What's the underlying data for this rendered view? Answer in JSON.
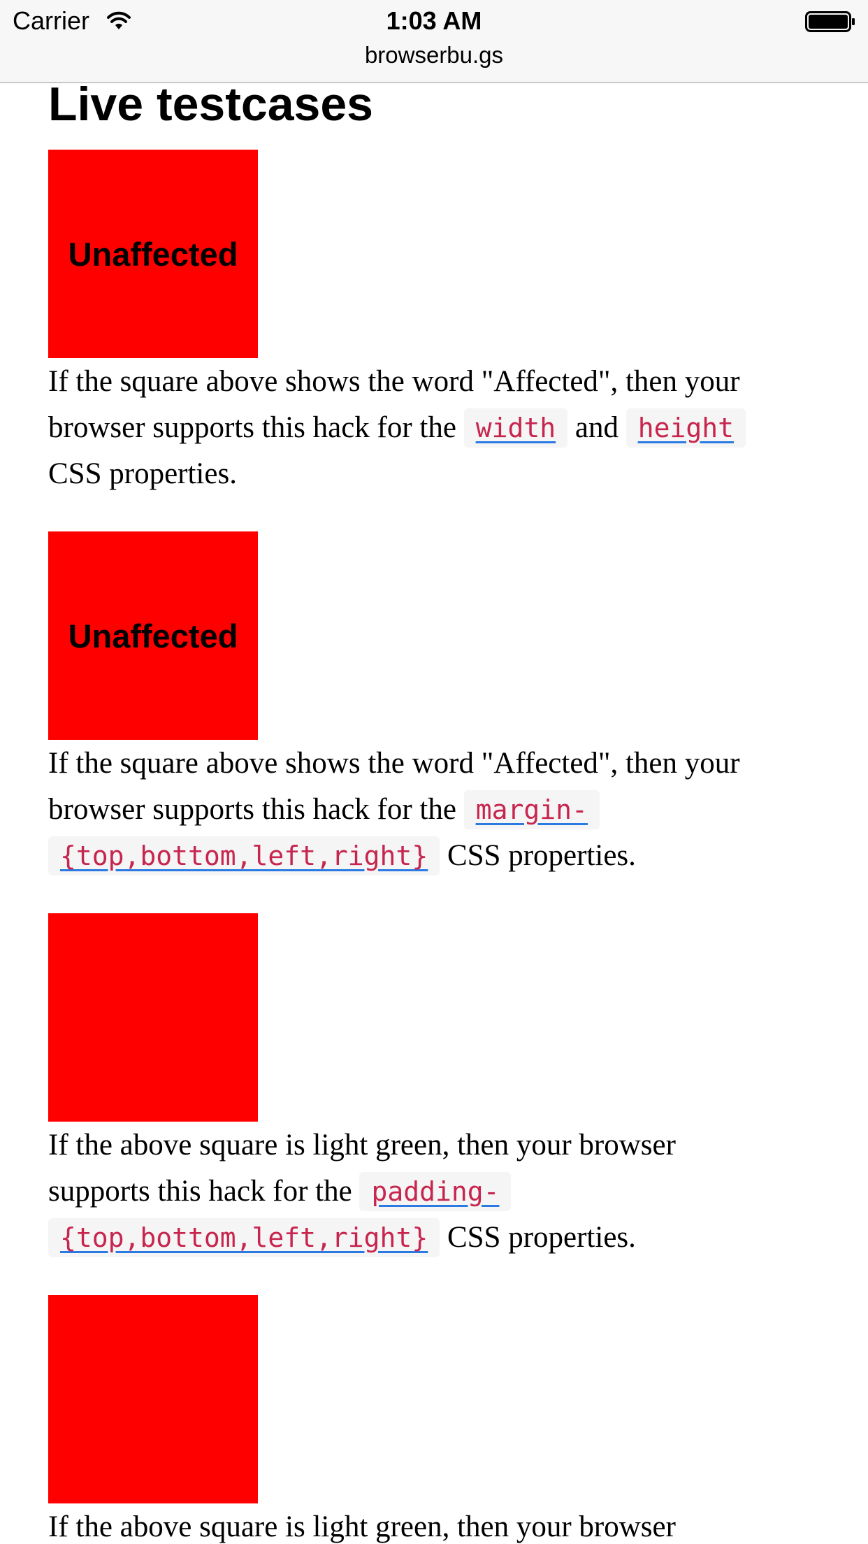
{
  "status_bar": {
    "carrier": "Carrier",
    "time": "1:03 AM",
    "wifi_icon": "wifi-icon",
    "battery_icon": "battery-full-icon"
  },
  "address_bar": {
    "url": "browserbu.gs"
  },
  "page": {
    "title": "Live testcases",
    "testcases": [
      {
        "square_label": "Unaffected",
        "square_color": "#ff0000",
        "text_before": "If the square above shows the word \"Affected\", then your browser supports this hack for the ",
        "code_1": "width",
        "text_middle": " and ",
        "code_2": "height",
        "text_after": " CSS properties."
      },
      {
        "square_label": "Unaffected",
        "square_color": "#ff0000",
        "text_before": "If the square above shows the word \"Affected\", then your browser supports this hack for the ",
        "code_1": "margin-{top,bottom,left,right}",
        "text_after": " CSS properties."
      },
      {
        "square_label": "",
        "square_color": "#ff0000",
        "text_before": "If the above square is light green, then your browser supports this hack for the ",
        "code_1": "padding-{top,bottom,left,right}",
        "text_after": " CSS properties."
      },
      {
        "square_label": "",
        "square_color": "#ff0000",
        "text_before": "If the above square is light green, then your browser"
      }
    ]
  },
  "colors": {
    "code_text": "#c7254e",
    "code_background": "#f5f5f5",
    "link_underline": "#2a7ae2",
    "square": "#ff0000"
  }
}
